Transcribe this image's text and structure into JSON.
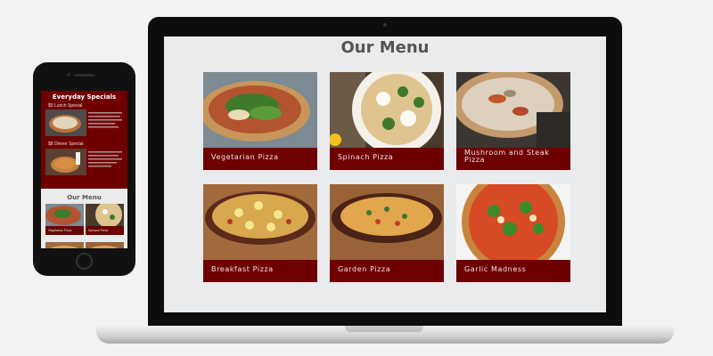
{
  "desktop": {
    "title": "Our Menu",
    "items": [
      {
        "name": "Vegetarian Pizza"
      },
      {
        "name": "Spinach Pizza"
      },
      {
        "name": "Mushroom and Steak Pizza"
      },
      {
        "name": "Breakfast Pizza"
      },
      {
        "name": "Garden Pizza"
      },
      {
        "name": "Garlic Madness"
      }
    ]
  },
  "mobile": {
    "specials_title": "Everyday Specials",
    "specials": [
      {
        "name": "$5 Lunch Special"
      },
      {
        "name": "$8 Dinner Special"
      }
    ],
    "menu_title": "Our Menu",
    "items": [
      {
        "name": "Vegetarian Pizza"
      },
      {
        "name": "Spinach Pizza"
      }
    ]
  },
  "colors": {
    "brand_dark_red": "#6e0000",
    "screen_bg": "#e9ebed",
    "page_bg": "#f2f2f2",
    "title_gray": "#555555"
  }
}
